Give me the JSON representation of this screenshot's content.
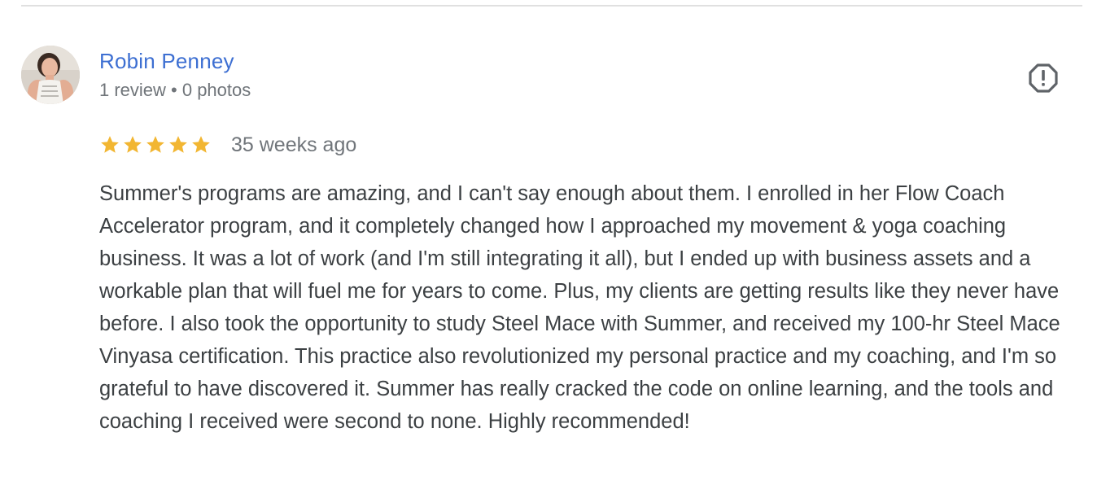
{
  "review": {
    "reviewer_name": "Robin Penney",
    "reviewer_meta": "1 review • 0 photos",
    "rating": 5,
    "rating_max": 5,
    "star_color": "#f2b632",
    "date": "35 weeks ago",
    "text": "Summer's programs are amazing, and I can't say enough about them. I enrolled in her Flow Coach Accelerator program, and it completely changed how I approached my movement & yoga coaching business. It was a lot of work (and I'm still integrating it all), but I ended up with business assets and a workable plan that will fuel me for years to come. Plus, my clients are getting results like they never have before. I also took the opportunity to study Steel Mace with Summer, and received my 100-hr Steel Mace Vinyasa certification. This practice also revolutionized my personal practice and my coaching, and I'm so grateful to have discovered it. Summer has really cracked the code on online learning, and the tools and coaching I received were second to none. Highly recommended!"
  },
  "icons": {
    "report": "report-flag-icon",
    "star": "star-icon",
    "avatar": "avatar"
  },
  "colors": {
    "name_link": "#3d6fd2",
    "meta_text": "#70757a",
    "body_text": "#3c4043",
    "divider": "#e0e0e0",
    "icon": "#5f6368"
  }
}
